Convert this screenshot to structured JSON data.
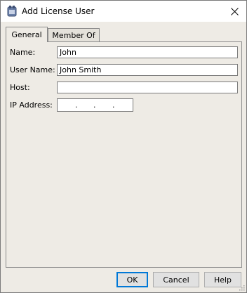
{
  "window": {
    "title": "Add License User",
    "app_icon": "app-icon",
    "close_icon": "close-icon"
  },
  "tabs": [
    {
      "label": "General",
      "active": true
    },
    {
      "label": "Member Of",
      "active": false
    }
  ],
  "form": {
    "name_label": "Name:",
    "name_value": "John",
    "username_label": "User Name:",
    "username_value": "John Smith",
    "host_label": "Host:",
    "host_value": "",
    "ip_label": "IP Address:",
    "ip_octets": [
      "",
      "",
      "",
      ""
    ]
  },
  "buttons": {
    "ok": "OK",
    "cancel": "Cancel",
    "help": "Help"
  }
}
